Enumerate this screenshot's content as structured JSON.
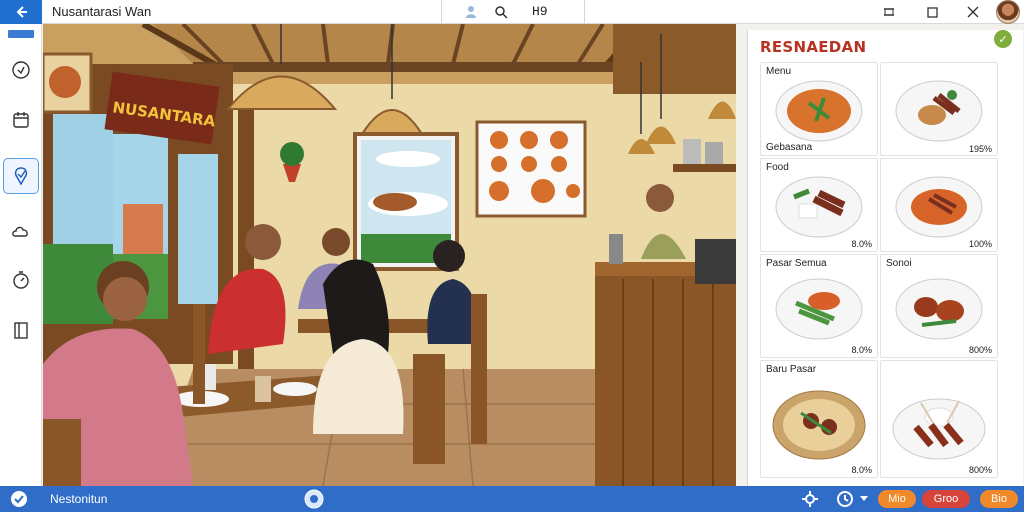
{
  "window": {
    "title": "Nusantarasi Wan",
    "breadcrumb_value": "H9"
  },
  "scene": {
    "sign_text": "NUSANTARA"
  },
  "menu": {
    "title": "RESNAEDAN",
    "badge": "✓",
    "items": [
      {
        "label": "Menu",
        "price": ""
      },
      {
        "label": "",
        "price": ""
      },
      {
        "label": "Gebasana",
        "price": ""
      },
      {
        "label": "",
        "price": "195%"
      },
      {
        "label": "Food",
        "price": "8.0%"
      },
      {
        "label": "",
        "price": "100%"
      },
      {
        "label": "Pasar Semua",
        "price": "8.0%"
      },
      {
        "label": "Sonoi",
        "price": "800%"
      },
      {
        "label": "Baru Pasar",
        "price": "8.0%"
      },
      {
        "label": "",
        "price": "800%"
      }
    ]
  },
  "statusbar": {
    "label": "Nestonitun",
    "buttons": [
      "Mio",
      "Groo",
      "Bio"
    ]
  },
  "colors": {
    "accent": "#2f6dc8",
    "menu_title": "#b83222",
    "pill_orange": "#f0892a",
    "pill_red": "#d7443a"
  }
}
